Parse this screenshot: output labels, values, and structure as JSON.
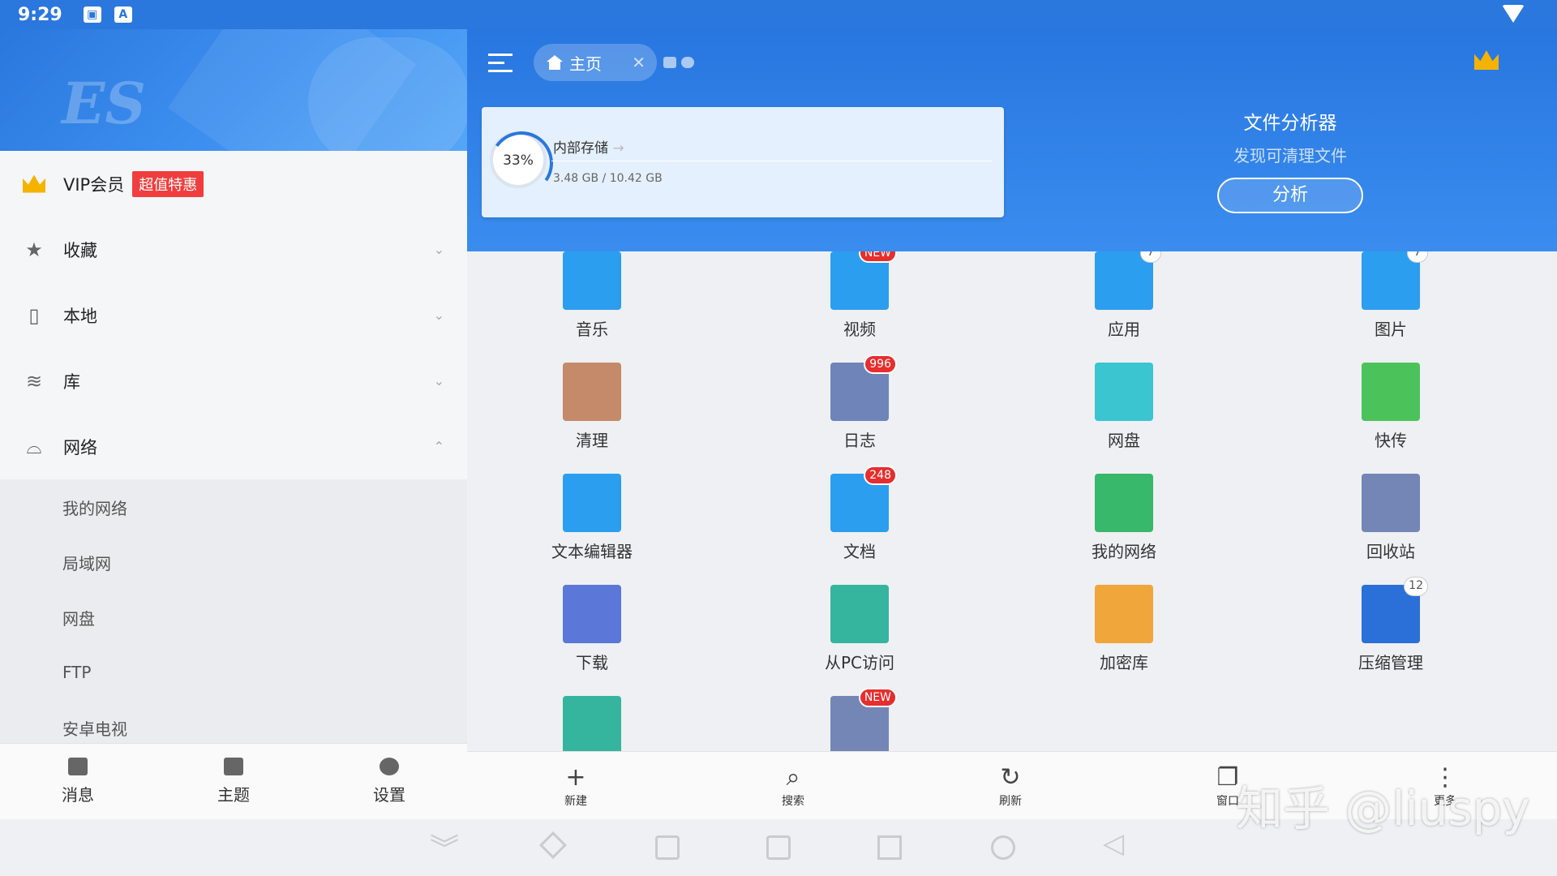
{
  "status_bar": {
    "time": "9:29"
  },
  "drawer": {
    "vip": {
      "label": "VIP会员",
      "badge": "超值特惠"
    },
    "sections": [
      {
        "label": "收藏",
        "icon": "star-icon"
      },
      {
        "label": "本地",
        "icon": "phone-icon"
      },
      {
        "label": "库",
        "icon": "layers-icon"
      },
      {
        "label": "网络",
        "icon": "router-icon"
      }
    ],
    "network_items": [
      "我的网络",
      "局域网",
      "网盘",
      "FTP",
      "安卓电视"
    ],
    "bottom": [
      {
        "label": "消息",
        "icon": "mail-icon"
      },
      {
        "label": "主题",
        "icon": "shirt-icon"
      },
      {
        "label": "设置",
        "icon": "gear-icon"
      }
    ]
  },
  "header": {
    "tab_label": "主页",
    "storage": {
      "percent": "33%",
      "name": "内部存储",
      "size": "3.48 GB / 10.42 GB",
      "used_fraction": 0.33
    },
    "analyzer": {
      "title": "文件分析器",
      "subtitle": "发现可清理文件",
      "button": "分析"
    }
  },
  "grid": [
    {
      "label": "音乐",
      "icon": "music-icon",
      "color": "#2b9ef0",
      "badge": ""
    },
    {
      "label": "视频",
      "icon": "video-icon",
      "color": "#2b9ef0",
      "badge": "NEW"
    },
    {
      "label": "应用",
      "icon": "android-icon",
      "color": "#2b9ef0",
      "badge": "7"
    },
    {
      "label": "图片",
      "icon": "image-icon",
      "color": "#2b9ef0",
      "badge": "7"
    },
    {
      "label": "清理",
      "icon": "broom-icon",
      "color": "#c48a6a",
      "badge": ""
    },
    {
      "label": "日志",
      "icon": "log-icon",
      "color": "#6f84b8",
      "badge": "996"
    },
    {
      "label": "网盘",
      "icon": "cloud-icon",
      "color": "#3ac5d0",
      "badge": ""
    },
    {
      "label": "快传",
      "icon": "transfer-icon",
      "color": "#4cc35a",
      "badge": ""
    },
    {
      "label": "文本编辑器",
      "icon": "edit-icon",
      "color": "#2b9ef0",
      "badge": ""
    },
    {
      "label": "文档",
      "icon": "doc-icon",
      "color": "#2b9ef0",
      "badge": "248"
    },
    {
      "label": "我的网络",
      "icon": "network-icon",
      "color": "#37b86a",
      "badge": ""
    },
    {
      "label": "回收站",
      "icon": "trash-icon",
      "color": "#7486b6",
      "badge": ""
    },
    {
      "label": "下载",
      "icon": "download-icon",
      "color": "#5b77d8",
      "badge": ""
    },
    {
      "label": "从PC访问",
      "icon": "pc-icon",
      "color": "#35b59e",
      "badge": ""
    },
    {
      "label": "加密库",
      "icon": "lock-icon",
      "color": "#f0a63a",
      "badge": ""
    },
    {
      "label": "压缩管理",
      "icon": "zip-icon",
      "color": "#2b6fd8",
      "badge": "12"
    },
    {
      "label": "",
      "icon": "screen-icon",
      "color": "#35b59e",
      "badge": ""
    },
    {
      "label": "",
      "icon": "add-icon",
      "color": "#7486b6",
      "badge": "NEW"
    }
  ],
  "toolbar": [
    {
      "label": "新建",
      "icon": "plus-icon",
      "glyph": "+"
    },
    {
      "label": "搜索",
      "icon": "search-icon",
      "glyph": "⌕"
    },
    {
      "label": "刷新",
      "icon": "refresh-icon",
      "glyph": "↻"
    },
    {
      "label": "窗口",
      "icon": "windows-icon",
      "glyph": "❐"
    },
    {
      "label": "更多",
      "icon": "more-icon",
      "glyph": "⋮"
    }
  ],
  "watermark": "知乎 @liuspy"
}
